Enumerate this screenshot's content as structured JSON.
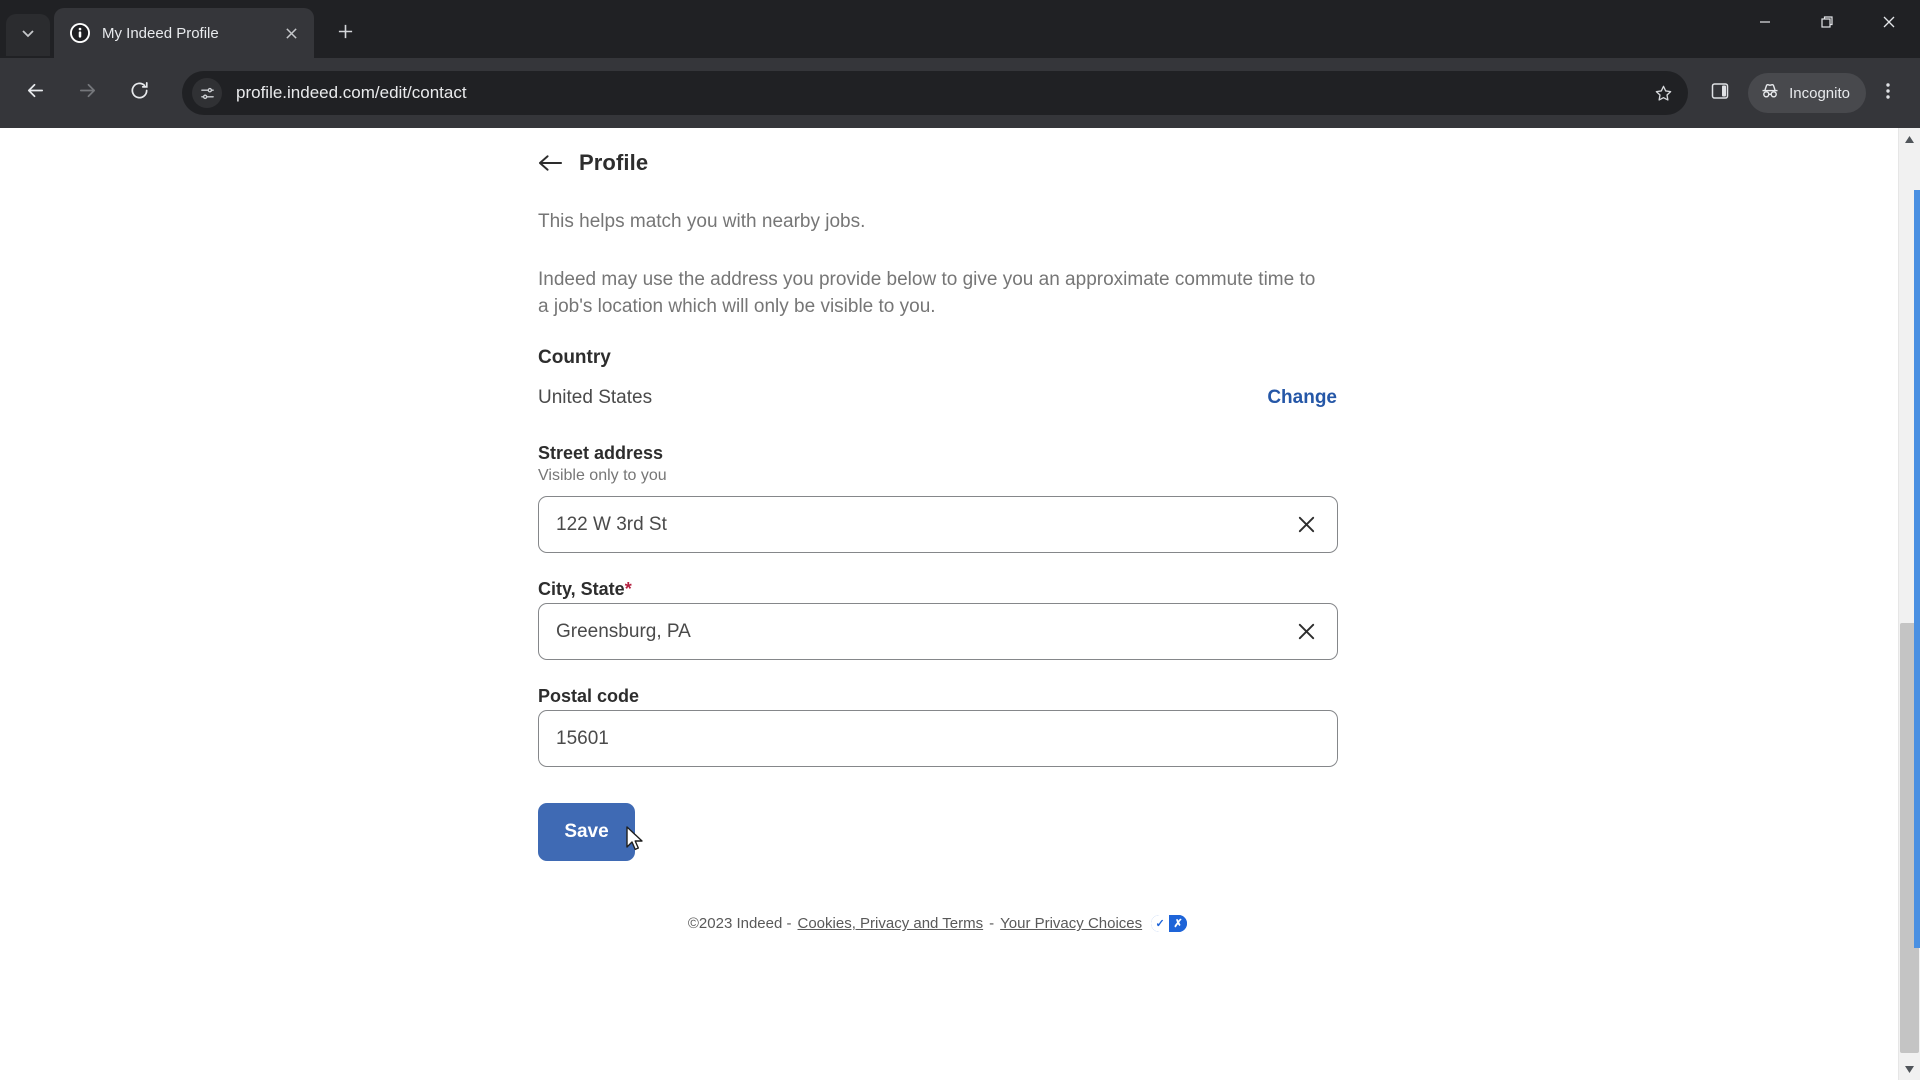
{
  "browser": {
    "tab": {
      "title": "My Indeed Profile",
      "favicon": "indeed-info-icon",
      "close_icon": "close-icon"
    },
    "tab_search_icon": "chevron-down-icon",
    "new_tab_icon": "plus-icon",
    "window_controls": [
      {
        "name": "minimize-button",
        "icon": "minimize-icon"
      },
      {
        "name": "maximize-button",
        "icon": "restore-icon"
      },
      {
        "name": "close-window-button",
        "icon": "close-icon"
      }
    ],
    "toolbar": {
      "back_icon": "back-arrow-icon",
      "forward_icon": "forward-arrow-icon",
      "reload_icon": "reload-icon",
      "site_info_icon": "site-settings-icon",
      "url": "profile.indeed.com/edit/contact",
      "bookmark_icon": "star-icon",
      "side_panel_icon": "side-panel-icon",
      "incognito_label": "Incognito",
      "incognito_icon": "incognito-hat-icon",
      "menu_icon": "three-dots-vertical-icon"
    }
  },
  "page": {
    "header": {
      "back_icon": "back-arrow-icon",
      "title": "Profile"
    },
    "paragraphs": [
      "This helps match you with nearby jobs.",
      "Indeed may use the address you provide below to give you an approximate commute time to a job's location which will only be visible to you."
    ],
    "country": {
      "label": "Country",
      "value": "United States",
      "change_label": "Change"
    },
    "fields": [
      {
        "label": "Street address",
        "hint": "Visible only to you",
        "value": "122 W 3rd St",
        "required": false,
        "clear_icon": "close-icon",
        "has_clear": true
      },
      {
        "label": "City, State",
        "hint": "",
        "value": "Greensburg, PA",
        "required": true,
        "required_marker": "*",
        "clear_icon": "close-icon",
        "has_clear": true
      },
      {
        "label": "Postal code",
        "hint": "",
        "value": "15601",
        "required": false,
        "clear_icon": "",
        "has_clear": false
      }
    ],
    "save_label": "Save",
    "footer": {
      "copyright": "©2023 Indeed -",
      "cookies_link": "Cookies, Privacy and Terms",
      "separator": "-",
      "privacy_link": "Your Privacy Choices",
      "badge_check": "✓",
      "badge_x": "✗"
    }
  },
  "colors": {
    "accent_blue": "#2557a7",
    "save_button": "#3f6ab4",
    "required_red": "#b4203f",
    "privacy_badge_blue": "#1e64d8",
    "scroll_highlight": "#4a90e2"
  }
}
